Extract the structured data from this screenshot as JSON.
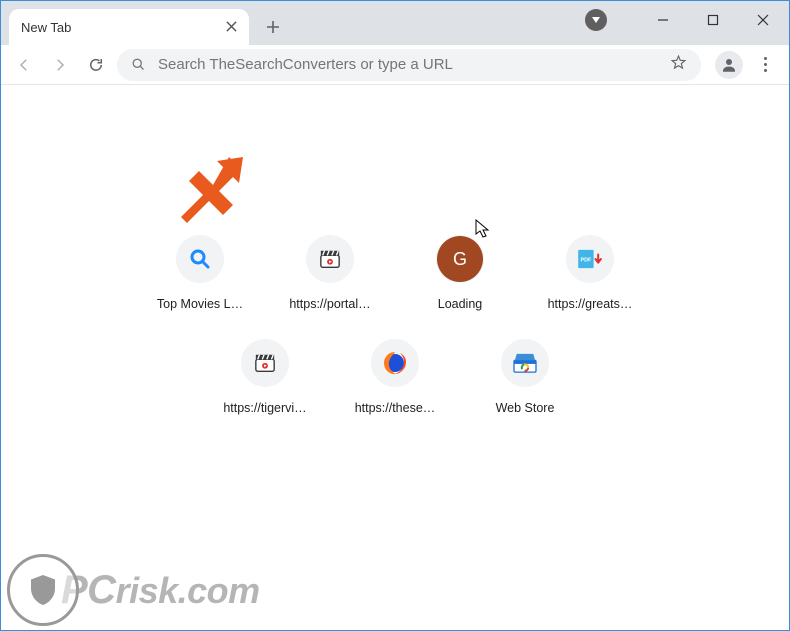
{
  "tab": {
    "title": "New Tab"
  },
  "omnibox": {
    "placeholder": "Search TheSearchConverters or type a URL"
  },
  "shortcuts": [
    {
      "label": "Top Movies L…",
      "icon": "magnifier"
    },
    {
      "label": "https://portal…",
      "icon": "clapper"
    },
    {
      "label": "Loading",
      "icon": "g"
    },
    {
      "label": "https://greats…",
      "icon": "pdf"
    },
    {
      "label": "https://tigervi…",
      "icon": "clapper"
    },
    {
      "label": "https://these…",
      "icon": "firefox"
    },
    {
      "label": "Web Store",
      "icon": "webstore"
    }
  ],
  "watermark": {
    "text_pc": "PC",
    "text_rest": "risk.com"
  }
}
